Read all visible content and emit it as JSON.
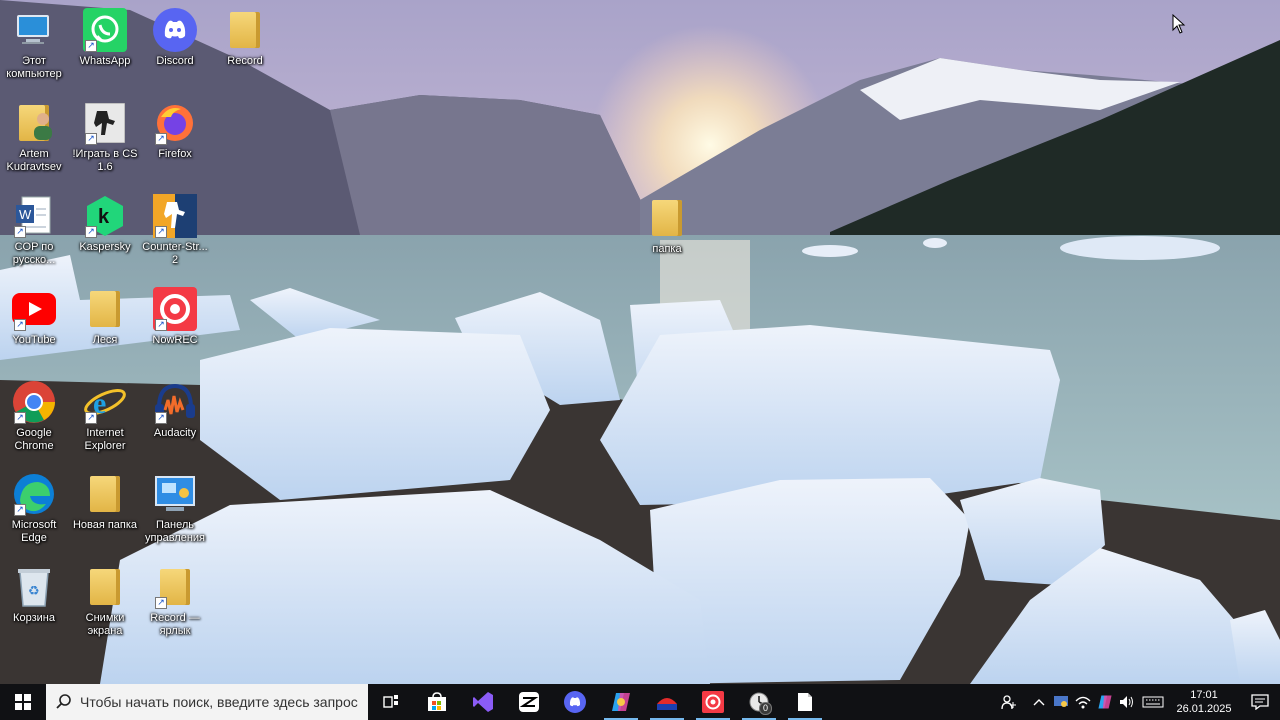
{
  "desktop_icons": [
    {
      "name": "this-pc",
      "label": "Этот компьютер"
    },
    {
      "name": "whatsapp",
      "label": "WhatsApp"
    },
    {
      "name": "discord",
      "label": "Discord"
    },
    {
      "name": "record",
      "label": "Record"
    },
    {
      "name": "artem",
      "label": "Artem Kudravtsev"
    },
    {
      "name": "cs16",
      "label": "!Играть в CS 1.6"
    },
    {
      "name": "firefox",
      "label": "Firefox"
    },
    {
      "name": "cop",
      "label": "COP по русско..."
    },
    {
      "name": "kaspersky",
      "label": "Kaspersky"
    },
    {
      "name": "counter-strike-2",
      "label": "Counter-Str... 2"
    },
    {
      "name": "youtube",
      "label": "YouTube"
    },
    {
      "name": "lesya",
      "label": "Леся"
    },
    {
      "name": "nowrec",
      "label": "NowREC"
    },
    {
      "name": "chrome",
      "label": "Google Chrome"
    },
    {
      "name": "ie",
      "label": "Internet Explorer"
    },
    {
      "name": "audacity",
      "label": "Audacity"
    },
    {
      "name": "edge",
      "label": "Microsoft Edge"
    },
    {
      "name": "new-folder",
      "label": "Новая папка"
    },
    {
      "name": "control-panel",
      "label": "Панель управления"
    },
    {
      "name": "recycle-bin",
      "label": "Корзина"
    },
    {
      "name": "screenshots",
      "label": "Снимки экрана"
    },
    {
      "name": "record-shortcut",
      "label": "Record — ярлык"
    },
    {
      "name": "papka",
      "label": "папка"
    }
  ],
  "taskbar": {
    "search_placeholder": "Чтобы начать поиск, введите здесь запрос",
    "apps": [
      "task-view",
      "microsoft-store",
      "visual-studio",
      "capcut",
      "discord",
      "copilot",
      "app-red-blue",
      "nowrec",
      "clock-app",
      "notepad"
    ],
    "clock_badge": "0"
  },
  "tray": {
    "time": "17:01",
    "date": "26.01.2025"
  }
}
